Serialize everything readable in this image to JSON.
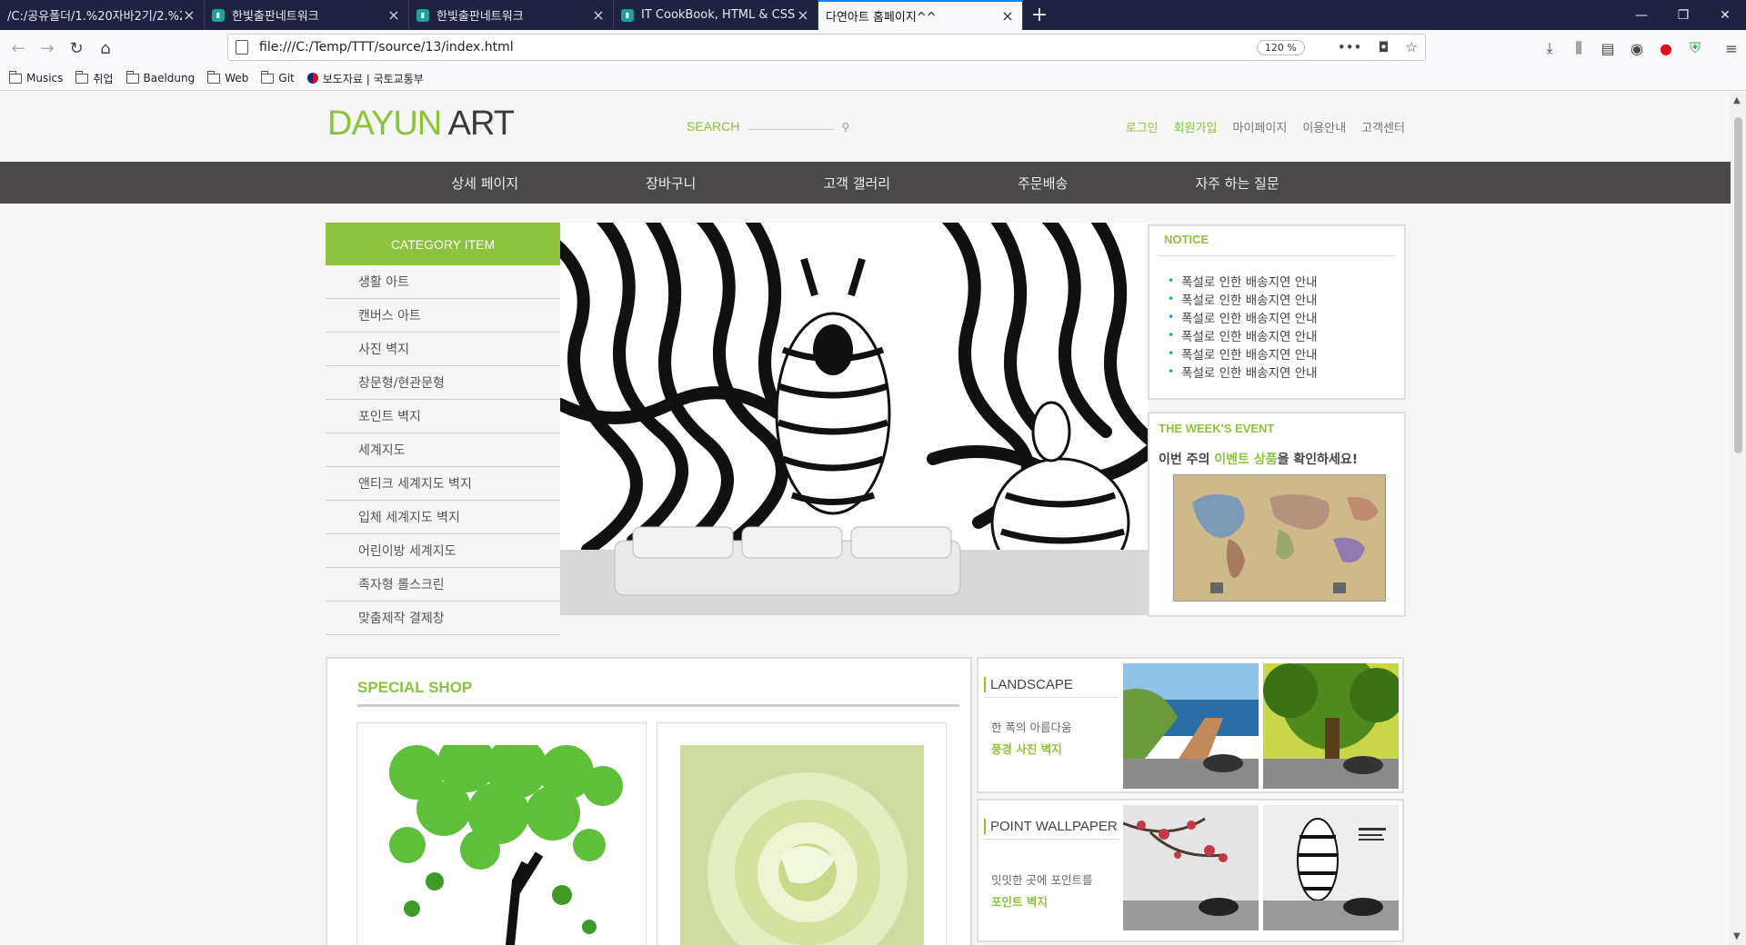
{
  "browser": {
    "tabs": [
      {
        "title": "/C:/공유폴더/1.%20자바2기/2.%2",
        "active": false
      },
      {
        "title": "한빛출판네트워크",
        "active": false
      },
      {
        "title": "한빛출판네트워크",
        "active": false
      },
      {
        "title": "IT CookBook, HTML & CSS for",
        "active": false
      },
      {
        "title": "다연아트 홈페이지^^",
        "active": true
      }
    ],
    "url": "file:///C:/Temp/TTT/source/13/index.html",
    "zoom": "120 %",
    "bookmarks": [
      {
        "label": "Musics",
        "icon": "folder-icon"
      },
      {
        "label": "취업",
        "icon": "folder-icon"
      },
      {
        "label": "Baeldung",
        "icon": "folder-icon"
      },
      {
        "label": "Web",
        "icon": "folder-icon"
      },
      {
        "label": "Git",
        "icon": "folder-icon"
      },
      {
        "label": "보도자료 | 국토교통부",
        "icon": "korea-flag-icon"
      }
    ]
  },
  "site": {
    "logo_green": "DAYUN",
    "logo_dark": " ART",
    "search_label": "SEARCH",
    "top_links": [
      "로그인",
      "회원가입",
      "마이페이지",
      "이용안내",
      "고객센터"
    ],
    "main_nav": [
      "상세 페이지",
      "장바구니",
      "고객 갤러리",
      "주문배송",
      "자주 하는 질문"
    ],
    "category_title": "CATEGORY ITEM",
    "categories": [
      "생활 아트",
      "캔버스 아트",
      "사진 벽지",
      "창문형/현관문형",
      "포인트 벽지",
      "세계지도",
      "앤티크 세계지도 벽지",
      "입체 세계지도 벽지",
      "어린이방 세계지도",
      "족자형 롤스크린",
      "맞춤제작 결제창"
    ],
    "notice_title": "NOTICE",
    "notices": [
      "폭설로 인한 배송지연 안내",
      "폭설로 인한 배송지연 안내",
      "폭설로 인한 배송지연 안내",
      "폭설로 인한 배송지연 안내",
      "폭설로 인한 배송지연 안내",
      "폭설로 인한 배송지연 안내"
    ],
    "event_title": "THE WEEK'S EVENT",
    "event_tag_1": "이번 주의 ",
    "event_tag_2": "이벤트 상품",
    "event_tag_3": "을 확인하세요!",
    "special_title": "SPECIAL SHOP",
    "landscape_title": "LANDSCAPE",
    "landscape_desc_1": "한 폭의 아름다움",
    "landscape_desc_2": "풍경 사진 벽지",
    "point_title": "POINT WALLPAPER",
    "point_desc_1": "밋밋한 곳에 포인트를",
    "point_desc_2": "포인트 벽지"
  },
  "colors": {
    "brand_green": "#8cc23c",
    "nav_dark": "#4a4848",
    "tab_bar": "#202340",
    "accent_blue": "#0a84ff"
  }
}
